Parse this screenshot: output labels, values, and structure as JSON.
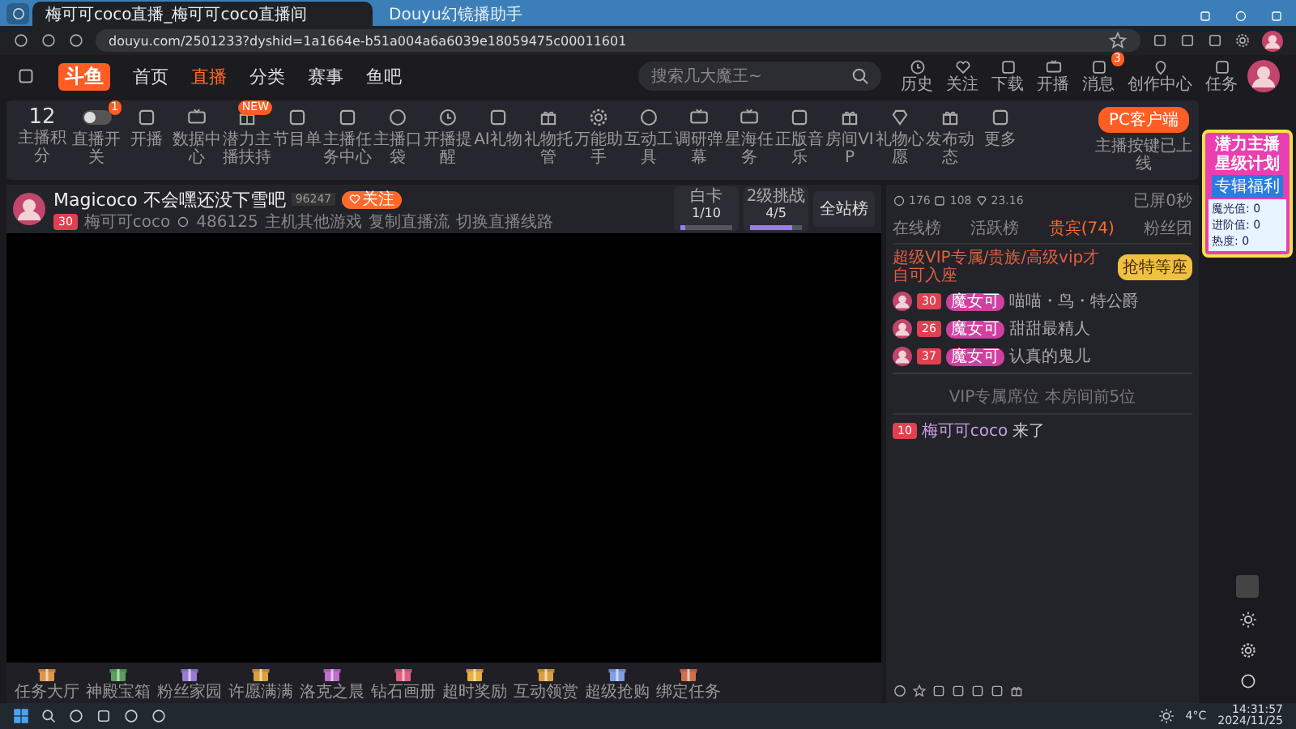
{
  "browser": {
    "tabs": [
      {
        "title": "梅可可coco直播_梅可可coco直播间",
        "selected": true
      },
      {
        "title": "Douyu幻镜播助手",
        "selected": false
      }
    ],
    "url": "douyu.com/2501233?dyshid=1a1664e-b51a004a6a6039e18059475c00011601"
  },
  "site_header": {
    "logo": "斗鱼",
    "nav": [
      {
        "label": "首页",
        "selected": false
      },
      {
        "label": "直播",
        "selected": true
      },
      {
        "label": "分类",
        "selected": false
      },
      {
        "label": "赛事",
        "selected": false
      },
      {
        "label": "鱼吧",
        "selected": false
      }
    ],
    "search": {
      "placeholder": "搜索几大魔王~"
    },
    "actions": [
      {
        "label": "历史"
      },
      {
        "label": "关注"
      },
      {
        "label": "下载"
      },
      {
        "label": "开播"
      },
      {
        "label": "消息",
        "badge": "3"
      },
      {
        "label": "创作中心"
      },
      {
        "label": "任务"
      }
    ]
  },
  "toolbar": {
    "score": {
      "value": "12",
      "label": "主播积分"
    },
    "items": [
      {
        "kind": "toggle",
        "label": "直播开关",
        "on": false,
        "badge": "1"
      },
      {
        "kind": "icon",
        "label": "开播"
      },
      {
        "kind": "icon",
        "label": "数据中心"
      },
      {
        "kind": "icon",
        "label": "潜力主播扶持",
        "badge": "NEW"
      },
      {
        "kind": "icon",
        "label": "节目单"
      },
      {
        "kind": "icon",
        "label": "主播任务中心"
      },
      {
        "kind": "icon",
        "label": "主播口袋"
      },
      {
        "kind": "icon",
        "label": "开播提醒"
      },
      {
        "kind": "icon",
        "label": "AI礼物"
      },
      {
        "kind": "icon",
        "label": "礼物托管"
      },
      {
        "kind": "icon",
        "label": "万能助手"
      },
      {
        "kind": "icon",
        "label": "互动工具"
      },
      {
        "kind": "icon",
        "label": "调研弹幕"
      },
      {
        "kind": "icon",
        "label": "星海任务"
      },
      {
        "kind": "icon",
        "label": "正版音乐"
      },
      {
        "kind": "icon",
        "label": "房间VIP"
      },
      {
        "kind": "icon",
        "label": "礼物心愿"
      },
      {
        "kind": "icon",
        "label": "发布动态"
      },
      {
        "kind": "icon",
        "label": "更多"
      }
    ],
    "pc_client": {
      "button": "PC客户端",
      "note": "主播按键已上线"
    }
  },
  "stream": {
    "title": "Magicoco 不会嘿还没下雪吧",
    "follow_count": "96247",
    "follow": "关注",
    "level": "30",
    "streamer": "梅可可coco",
    "hot": "486125",
    "links": [
      "主机其他游戏",
      "复制直播流",
      "切换直播线路"
    ],
    "challenges": [
      {
        "label": "白卡",
        "progress": "1/10",
        "level": 0.1
      },
      {
        "label": "2级挑战",
        "progress": "4/5",
        "level": 0.8
      }
    ],
    "rank_button": "全站榜"
  },
  "gift_bar": {
    "items": [
      "任务大厅",
      "神殿宝箱",
      "粉丝家园",
      "许愿满满",
      "洛克之晨",
      "钻石画册",
      "超时奖励",
      "互动领赏",
      "超级抢购",
      "绑定任务"
    ]
  },
  "side_panel": {
    "stats": [
      "176",
      "108",
      "23.16"
    ],
    "muted": "已屏0秒",
    "tabs": [
      {
        "label": "在线榜",
        "selected": false
      },
      {
        "label": "活跃榜",
        "selected": false
      },
      {
        "label": "贵宾(74)",
        "selected": true
      },
      {
        "label": "粉丝团",
        "selected": false
      }
    ],
    "notice": "超级VIP专属/贵族/高级vip才自可入座",
    "notice_button": "抢特等座",
    "seats": [
      {
        "level": "30",
        "badge": "魔女可",
        "message": "喵喵・鸟・特公爵"
      },
      {
        "level": "26",
        "badge": "魔女可",
        "message": "甜甜最精人"
      },
      {
        "level": "37",
        "badge": "魔女可",
        "message": "认真的鬼儿"
      }
    ],
    "seat_divider": "VIP专属席位 本房间前5位",
    "chat": [
      {
        "level": "10",
        "user": "梅可可coco",
        "text": "来了"
      }
    ]
  },
  "promo": {
    "title": "潜力主播",
    "subtitle": "星级计划",
    "button": "专辑福利",
    "stats": [
      "魔光值: 0",
      "进阶值: 0",
      "热度: 0"
    ]
  },
  "taskbar": {
    "weather": "4°C",
    "time": "14:31:57",
    "date": "2024/11/25"
  }
}
